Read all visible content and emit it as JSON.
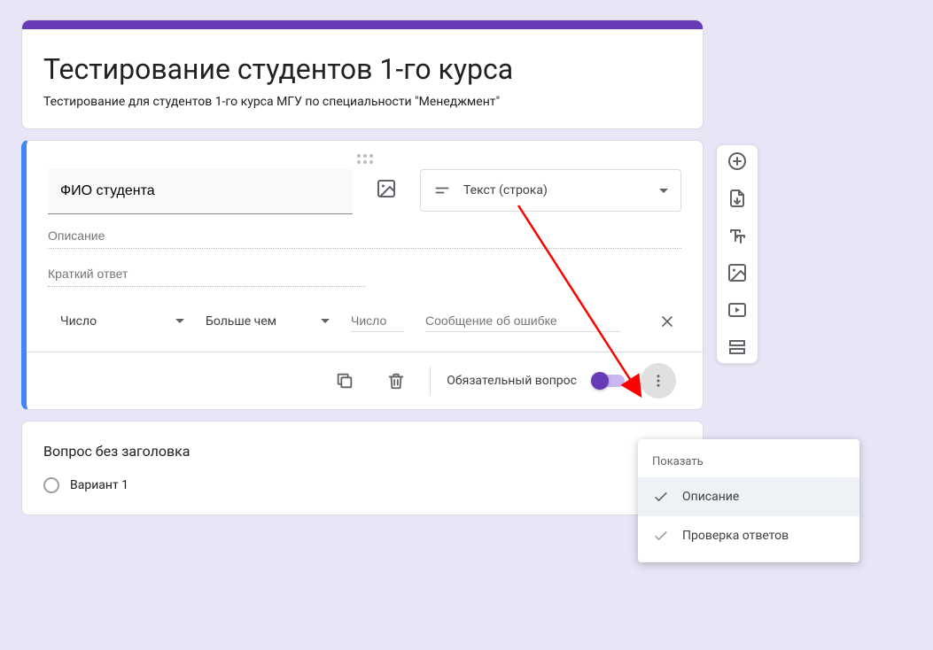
{
  "header": {
    "title": "Тестирование студентов 1-го курса",
    "description": "Тестирование для студентов 1-го курса МГУ по специальности \"Менеджмент\""
  },
  "question": {
    "title": "ФИО студента",
    "type_label": "Текст (строка)",
    "description_placeholder": "Описание",
    "short_answer_placeholder": "Краткий ответ",
    "validation": {
      "type": "Число",
      "operator": "Больше чем",
      "value_placeholder": "Число",
      "error_placeholder": "Сообщение об ошибке"
    },
    "required_label": "Обязательный вопрос",
    "required_on": true
  },
  "question2": {
    "title": "Вопрос без заголовка",
    "option": "Вариант 1"
  },
  "menu": {
    "header": "Показать",
    "item_description": "Описание",
    "item_validation": "Проверка ответов"
  },
  "icons": {
    "add": "add-circle",
    "import": "import",
    "text": "text-title",
    "image": "image",
    "video": "video",
    "section": "section"
  }
}
